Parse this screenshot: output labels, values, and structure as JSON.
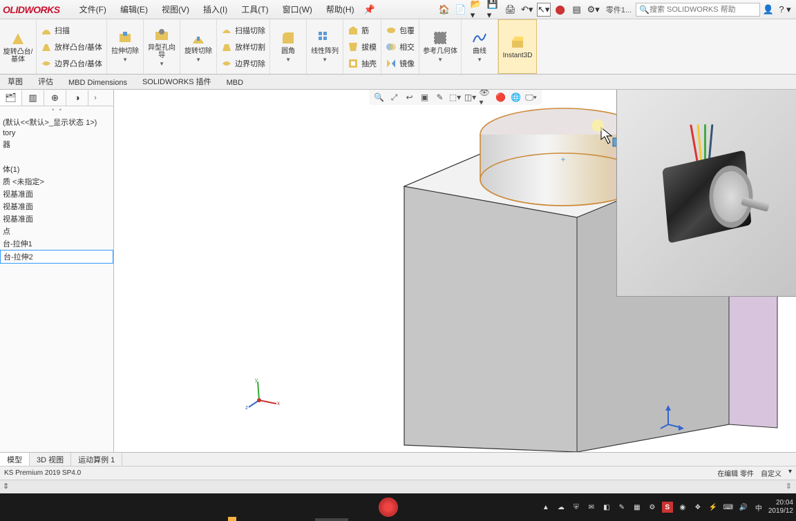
{
  "app": {
    "logo": "OLIDWORKS"
  },
  "menu": {
    "file": "文件(F)",
    "edit": "编辑(E)",
    "view": "视图(V)",
    "insert": "插入(I)",
    "tools": "工具(T)",
    "window": "窗口(W)",
    "help": "帮助(H)"
  },
  "doc_label": "零件1...",
  "search_placeholder": "搜索 SOLIDWORKS 帮助",
  "ribbon": {
    "revolve_boss": "旋转凸台/基体",
    "sweep": "扫描",
    "loft_boss": "放样凸台/基体",
    "boundary_boss": "边界凸台/基体",
    "extrude_cut": "拉伸切除",
    "hole_wizard": "异型孔向导",
    "revolve_cut": "旋转切除",
    "sweep_cut": "扫描切除",
    "loft_cut": "放样切割",
    "boundary_cut": "边界切除",
    "fillet": "圆角",
    "linear_pattern": "线性阵列",
    "rib": "筋",
    "draft": "拔模",
    "shell": "抽壳",
    "wrap": "包覆",
    "intersect": "相交",
    "mirror": "镜像",
    "ref_geom": "参考几何体",
    "curves": "曲线",
    "instant3d": "Instant3D"
  },
  "cmd_tabs": {
    "sketch": "草图",
    "evaluate": "评估",
    "mbd_dim": "MBD Dimensions",
    "plugins": "SOLIDWORKS 插件",
    "mbd": "MBD"
  },
  "tree": {
    "config": "(默认<<默认>_显示状态 1>)",
    "history": "tory",
    "sensor": "器",
    "solid_body": "体(1)",
    "material": "质 <未指定>",
    "front_plane": "视基准面",
    "top_plane": "视基准面",
    "right_plane": "视基准面",
    "origin": "点",
    "extrude1": "台-拉伸1",
    "extrude2": "台-拉伸2"
  },
  "bottom_tabs": {
    "model": "模型",
    "view3d": "3D 视图",
    "motion": "运动算例 1"
  },
  "status": {
    "version": "KS Premium 2019 SP4.0",
    "editing": "在编辑 零件",
    "custom": "自定义"
  },
  "taskbar": {
    "ime": "中",
    "time": "20:04",
    "date": "2019/12"
  },
  "tray_icons": [
    "▲",
    "☁",
    "⛨",
    "✉",
    "◧",
    "✎",
    "▦",
    "⚙",
    "S",
    "◉",
    "❖",
    "⚡",
    "⌨",
    "🔊",
    "中"
  ],
  "colors": {
    "accent": "#c8102e",
    "select": "#cde6f7",
    "ribbon_hi": "#fff0c4"
  }
}
